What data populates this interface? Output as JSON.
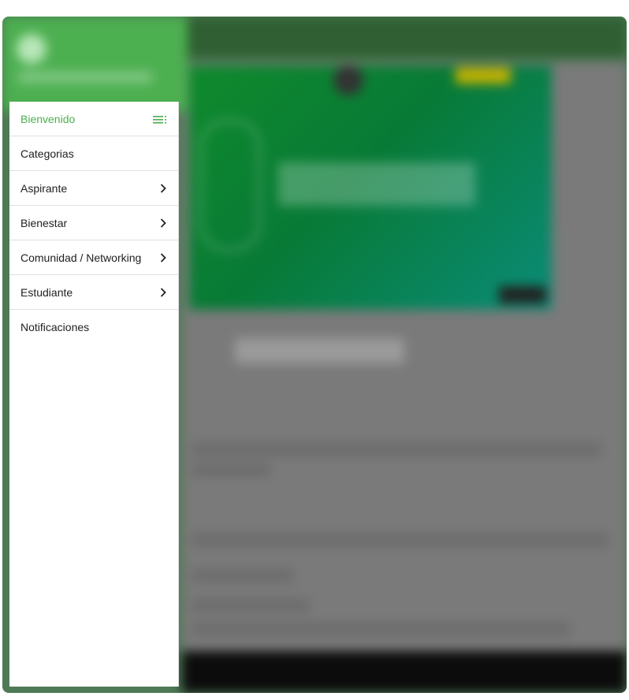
{
  "theme": {
    "accent": "#4caf50",
    "text": "#212121",
    "divider": "#e0e0e0",
    "backdrop_frame": "#4f7a56"
  },
  "drawer": {
    "items": [
      {
        "label": "Bienvenido",
        "active": true,
        "icon": "menu-lines-icon"
      },
      {
        "label": "Categorias",
        "active": false
      },
      {
        "label": "Aspirante",
        "active": false,
        "icon": "chevron-right-icon"
      },
      {
        "label": "Bienestar",
        "active": false,
        "icon": "chevron-right-icon"
      },
      {
        "label": "Comunidad / Networking",
        "active": false,
        "icon": "chevron-right-icon"
      },
      {
        "label": "Estudiante",
        "active": false,
        "icon": "chevron-right-icon"
      },
      {
        "label": "Notificaciones",
        "active": false
      }
    ]
  }
}
